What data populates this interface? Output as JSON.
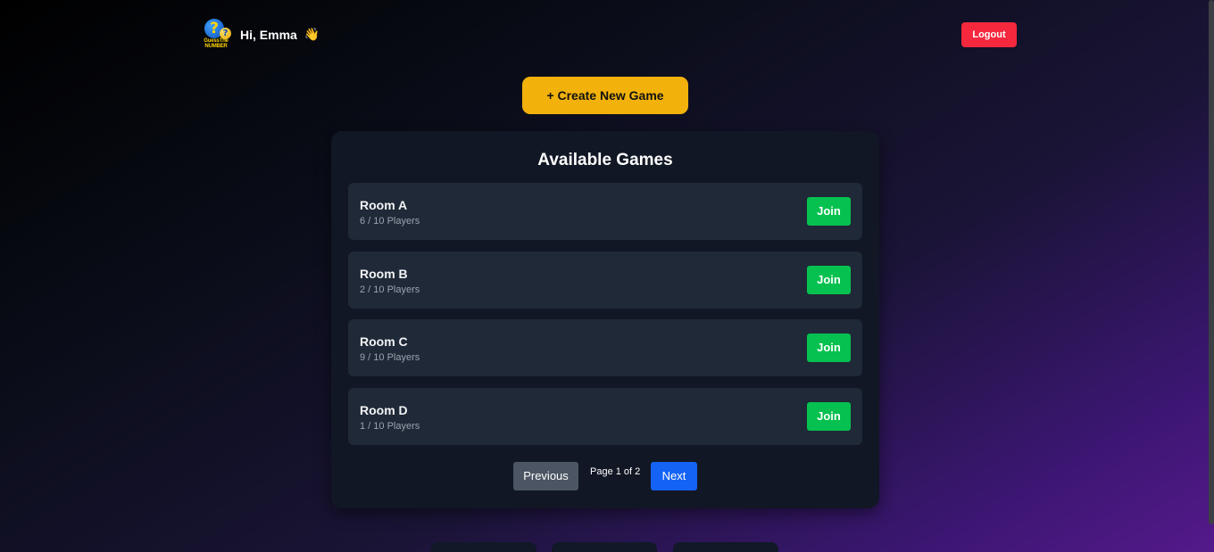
{
  "header": {
    "logo": {
      "mark_primary": "?",
      "mark_secondary": "?",
      "line1": "GuessThe",
      "line2": "NUMBER"
    },
    "greeting": "Hi, Emma",
    "wave_emoji": "👋",
    "logout_label": "Logout"
  },
  "actions": {
    "create_label": "+ Create New Game"
  },
  "lobby": {
    "title": "Available Games",
    "rooms": [
      {
        "name": "Room A",
        "players": "6 / 10 Players",
        "join_label": "Join"
      },
      {
        "name": "Room B",
        "players": "2 / 10 Players",
        "join_label": "Join"
      },
      {
        "name": "Room C",
        "players": "9 / 10 Players",
        "join_label": "Join"
      },
      {
        "name": "Room D",
        "players": "1 / 10 Players",
        "join_label": "Join"
      }
    ],
    "pagination": {
      "previous_label": "Previous",
      "page_info": "Page 1 of 2",
      "next_label": "Next"
    }
  },
  "colors": {
    "accent_yellow": "#f2b20b",
    "logout_red": "#f5283d",
    "join_green": "#06c150",
    "next_blue": "#1463f5",
    "panel_bg": "#111724",
    "row_bg": "#1f2937"
  }
}
